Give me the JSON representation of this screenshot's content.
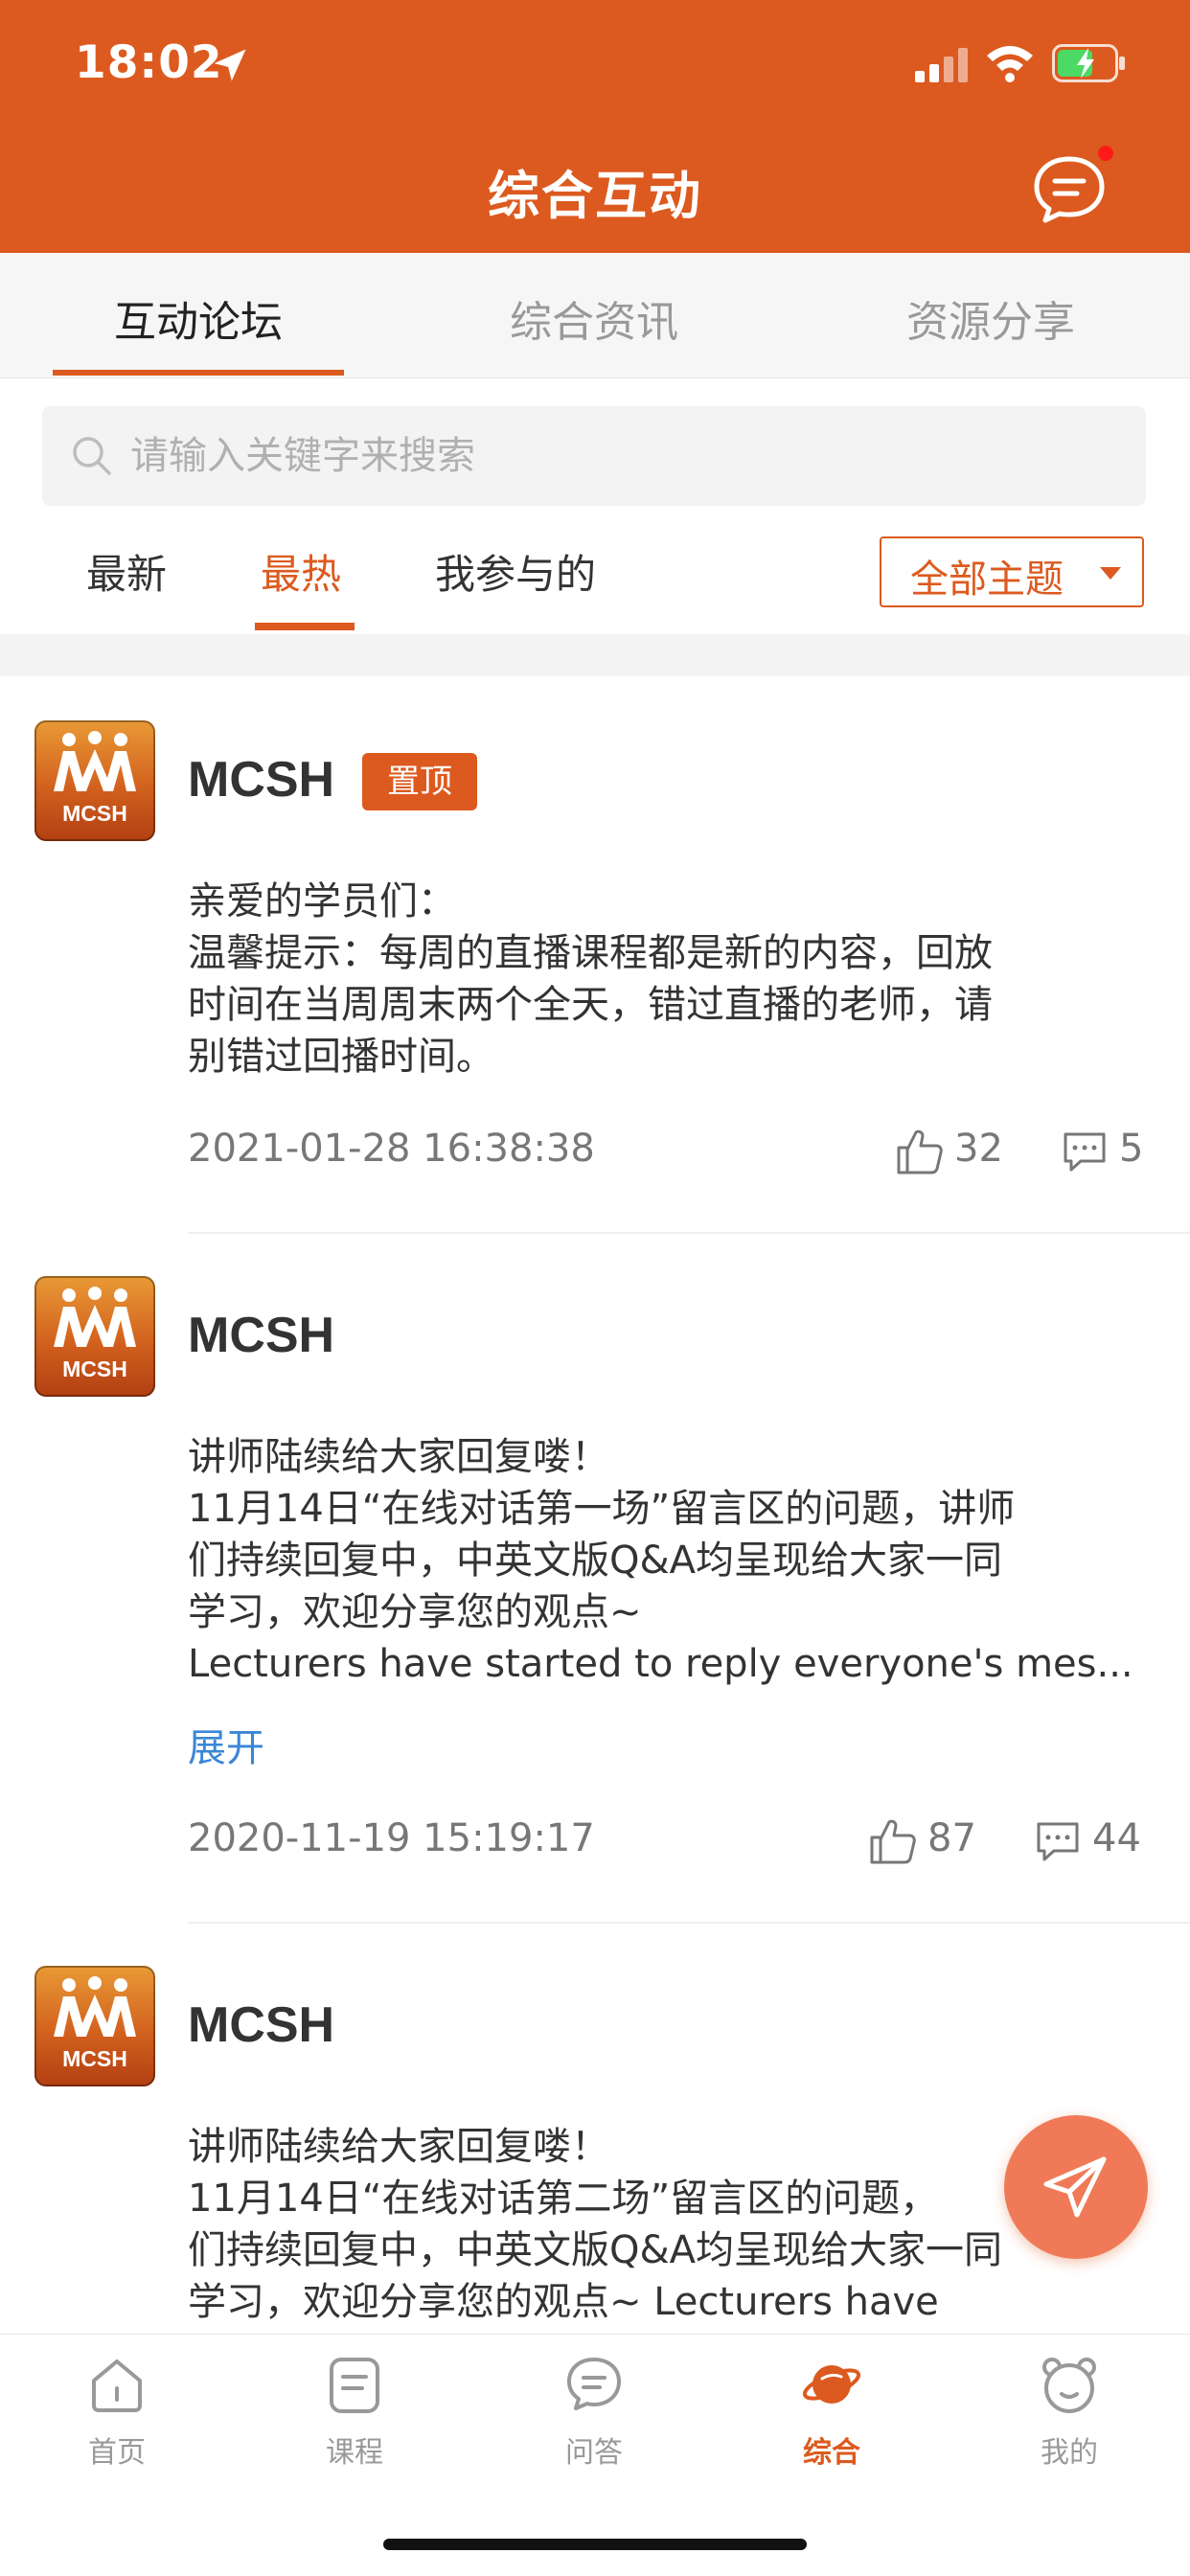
{
  "status_bar": {
    "time": "18:02"
  },
  "header": {
    "title": "综合互动"
  },
  "top_tabs": [
    {
      "label": "互动论坛"
    },
    {
      "label": "综合资讯"
    },
    {
      "label": "资源分享"
    }
  ],
  "search": {
    "placeholder": "请输入关键字来搜索"
  },
  "sub_tabs": [
    {
      "label": "最新"
    },
    {
      "label": "最热"
    },
    {
      "label": "我参与的"
    }
  ],
  "topic_filter": {
    "label": "全部主题"
  },
  "posts": [
    {
      "avatar_text": "MCSH",
      "author": "MCSH",
      "badge": "置顶",
      "lines": [
        "亲爱的学员们：",
        "温馨提示：每周的直播课程都是新的内容，回放",
        "时间在当周周末两个全天，错过直播的老师，请",
        "别错过回播时间。"
      ],
      "time": "2021-01-28 16:38:38",
      "likes": "32",
      "comments": "5"
    },
    {
      "avatar_text": "MCSH",
      "author": "MCSH",
      "lines": [
        "讲师陆续给大家回复喽！",
        "11月14日“在线对话第一场”留言区的问题，讲师",
        "们持续回复中，中英文版Q&A均呈现给大家一同",
        "学习，欢迎分享您的观点~",
        "Lecturers have started to reply everyone's mes..."
      ],
      "expand": "展开",
      "time": "2020-11-19 15:19:17",
      "likes": "87",
      "comments": "44"
    },
    {
      "avatar_text": "MCSH",
      "author": "MCSH",
      "lines": [
        "讲师陆续给大家回复喽！",
        "11月14日“在线对话第二场”留言区的问题，",
        "们持续回复中，中英文版Q&A均呈现给大家一同",
        "学习，欢迎分享您的观点~ Lecturers have"
      ]
    }
  ],
  "bottom_nav": [
    {
      "label": "首页",
      "icon": "home-icon"
    },
    {
      "label": "课程",
      "icon": "course-icon"
    },
    {
      "label": "问答",
      "icon": "qa-icon"
    },
    {
      "label": "综合",
      "icon": "planet-icon"
    },
    {
      "label": "我的",
      "icon": "bear-icon"
    }
  ],
  "colors": {
    "brand": "#DC5A1F",
    "fab": "#F07A57",
    "link": "#3A86D6"
  }
}
